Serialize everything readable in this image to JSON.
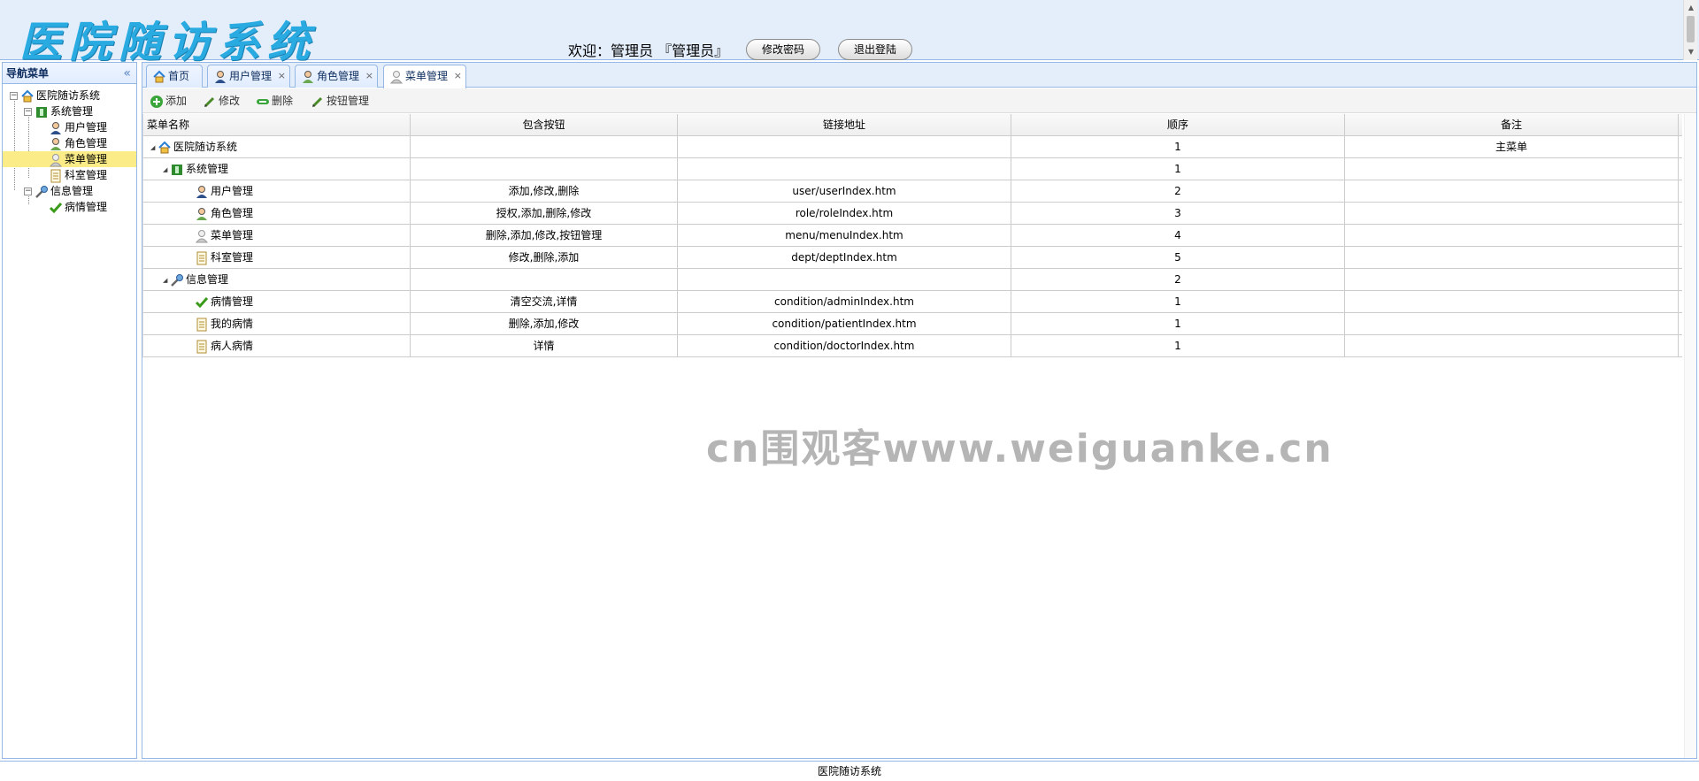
{
  "header": {
    "logo": "医院随访系统",
    "welcome": "欢迎：管理员 『管理员』",
    "change_password": "修改密码",
    "logout": "退出登陆"
  },
  "sidebar": {
    "title": "导航菜单",
    "collapse": "«",
    "tree": {
      "root": "医院随访系统",
      "group1": "系统管理",
      "group1_items": [
        "用户管理",
        "角色管理",
        "菜单管理",
        "科室管理"
      ],
      "group2": "信息管理",
      "group2_items": [
        "病情管理"
      ]
    }
  },
  "tabs": [
    {
      "label": "首页",
      "closable": false
    },
    {
      "label": "用户管理",
      "closable": true
    },
    {
      "label": "角色管理",
      "closable": true
    },
    {
      "label": "菜单管理",
      "closable": true
    }
  ],
  "tab_close": "×",
  "toolbar": {
    "add": "添加",
    "edit": "修改",
    "delete": "删除",
    "button_manage": "按钮管理"
  },
  "grid": {
    "columns": [
      "菜单名称",
      "包含按钮",
      "链接地址",
      "顺序",
      "备注"
    ],
    "rows": [
      {
        "name": "医院随访系统",
        "buttons": "",
        "url": "",
        "order": "1",
        "note": "主菜单"
      },
      {
        "name": "系统管理",
        "buttons": "",
        "url": "",
        "order": "1",
        "note": ""
      },
      {
        "name": "用户管理",
        "buttons": "添加,修改,删除",
        "url": "user/userIndex.htm",
        "order": "2",
        "note": ""
      },
      {
        "name": "角色管理",
        "buttons": "授权,添加,删除,修改",
        "url": "role/roleIndex.htm",
        "order": "3",
        "note": ""
      },
      {
        "name": "菜单管理",
        "buttons": "删除,添加,修改,按钮管理",
        "url": "menu/menuIndex.htm",
        "order": "4",
        "note": ""
      },
      {
        "name": "科室管理",
        "buttons": "修改,删除,添加",
        "url": "dept/deptIndex.htm",
        "order": "5",
        "note": ""
      },
      {
        "name": "信息管理",
        "buttons": "",
        "url": "",
        "order": "2",
        "note": ""
      },
      {
        "name": "病情管理",
        "buttons": "清空交流,详情",
        "url": "condition/adminIndex.htm",
        "order": "1",
        "note": ""
      },
      {
        "name": "我的病情",
        "buttons": "删除,添加,修改",
        "url": "condition/patientIndex.htm",
        "order": "1",
        "note": ""
      },
      {
        "name": "病人病情",
        "buttons": "详情",
        "url": "condition/doctorIndex.htm",
        "order": "1",
        "note": ""
      }
    ]
  },
  "footer": "医院随访系统",
  "watermark": "cn围观客www.weiguanke.cn",
  "colors": {
    "accent": "#95b8e7",
    "header_bg": "#e4eefb",
    "logo": "#29abe2",
    "selected": "#fbec88"
  }
}
